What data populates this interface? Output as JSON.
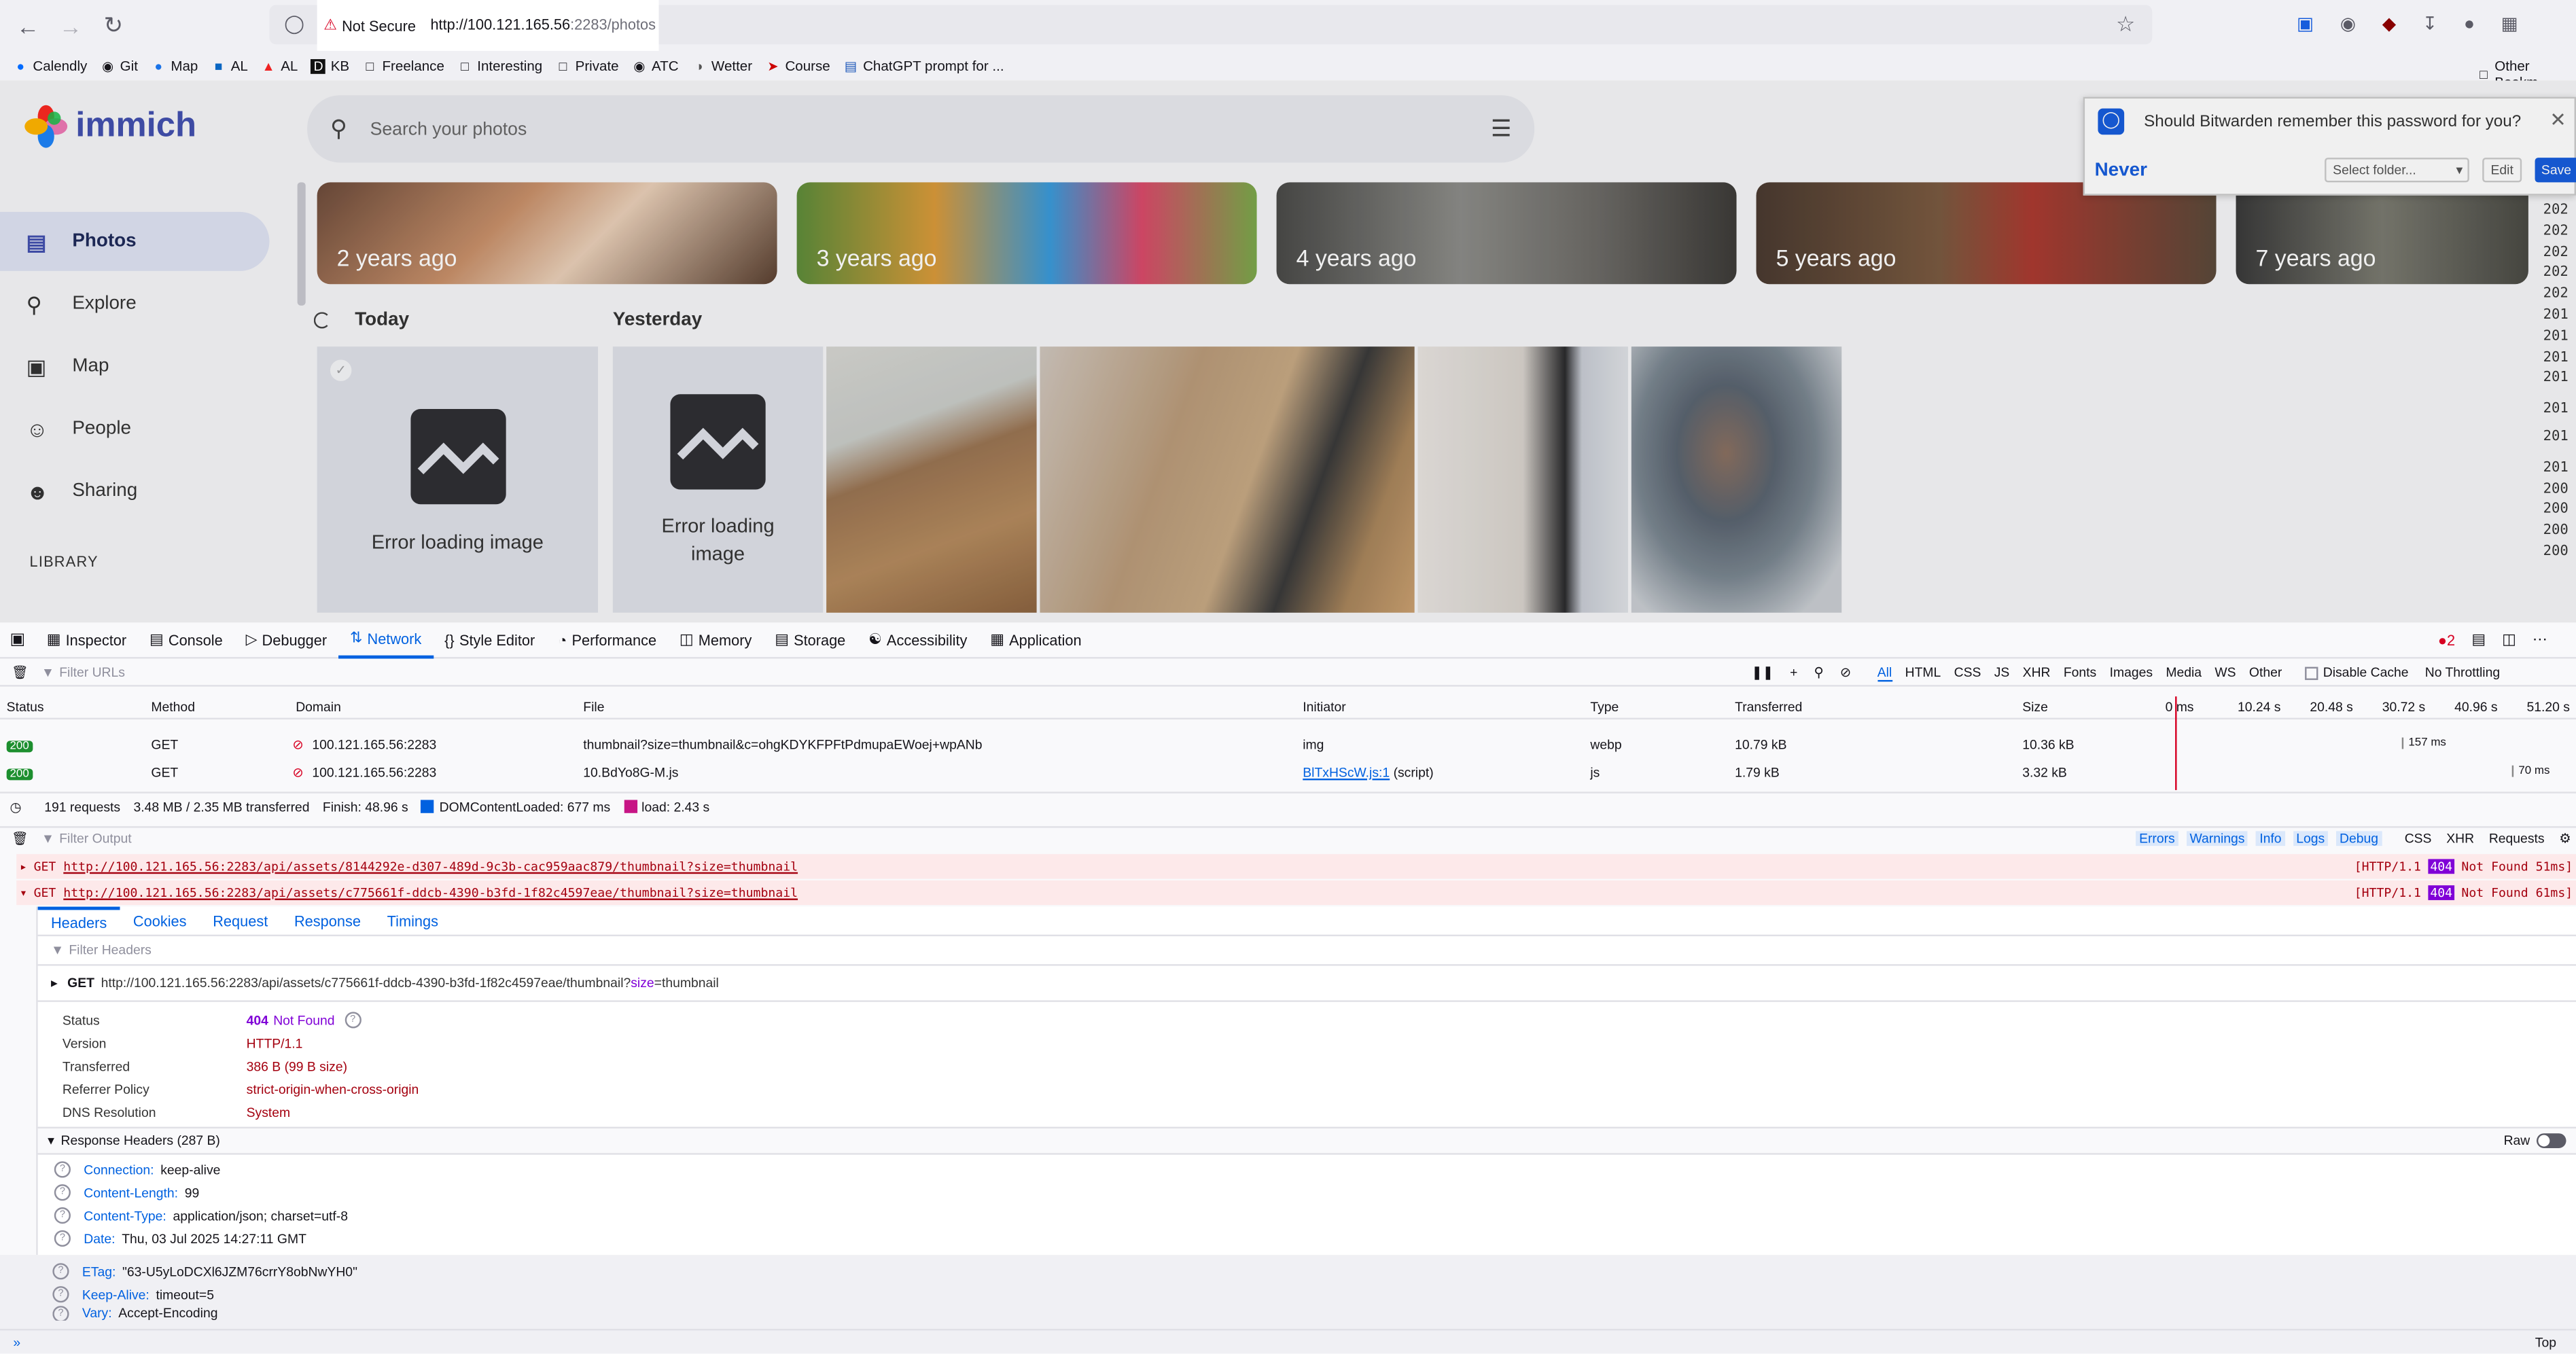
{
  "browser": {
    "security_label": "Not Secure",
    "url_host": "http://100.121.165.56",
    "url_rest": ":2283/photos",
    "bookmarks": [
      "Calendly",
      "Git",
      "Map",
      "AL",
      "AL",
      "KB",
      "Freelance",
      "Interesting",
      "Private",
      "ATC",
      "Wetter",
      "Course",
      "ChatGPT prompt for ..."
    ],
    "other_bookmarks": "Other Bookm"
  },
  "app": {
    "logo_text": "immich",
    "search_placeholder": "Search your photos",
    "nav": [
      "Photos",
      "Explore",
      "Map",
      "People",
      "Sharing"
    ],
    "library_heading": "LIBRARY",
    "memories": [
      "2 years ago",
      "3 years ago",
      "4 years ago",
      "5 years ago",
      "7 years ago"
    ],
    "groups": {
      "today": "Today",
      "yesterday": "Yesterday"
    },
    "error_text": "Error loading image",
    "timeline_years": [
      "202",
      "202",
      "202",
      "202",
      "202",
      "201",
      "201",
      "201",
      "201",
      "201",
      "201",
      "201",
      "200",
      "200",
      "200",
      "200"
    ]
  },
  "bitwarden": {
    "question": "Should Bitwarden remember this password for you?",
    "never": "Never",
    "folder_placeholder": "Select folder...",
    "edit": "Edit",
    "save": "Save"
  },
  "devtools": {
    "tabs": [
      "Inspector",
      "Console",
      "Debugger",
      "Network",
      "Style Editor",
      "Performance",
      "Memory",
      "Storage",
      "Accessibility",
      "Application"
    ],
    "error_count": "2",
    "filter_urls": "Filter URLs",
    "type_filters": [
      "All",
      "HTML",
      "CSS",
      "JS",
      "XHR",
      "Fonts",
      "Images",
      "Media",
      "WS",
      "Other"
    ],
    "disable_cache": "Disable Cache",
    "throttling": "No Throttling",
    "columns": [
      "Status",
      "Method",
      "Domain",
      "File",
      "Initiator",
      "Type",
      "Transferred",
      "Size"
    ],
    "timeline_ticks": [
      "0 ms",
      "10.24 s",
      "20.48 s",
      "30.72 s",
      "40.96 s",
      "51.20 s"
    ],
    "rows": [
      {
        "status": "200",
        "method": "GET",
        "domain": "100.121.165.56:2283",
        "file": "thumbnail?size=thumbnail&c=ohgKDYKFPFtPdmupaEWoej+wpANb",
        "initiator": "img",
        "type": "webp",
        "transferred": "10.79 kB",
        "size": "10.36 kB",
        "timing": "157 ms"
      },
      {
        "status": "200",
        "method": "GET",
        "domain": "100.121.165.56:2283",
        "file": "10.BdYo8G-M.js",
        "initiator": "BlTxHScW.js:1",
        "initiator_suffix": "(script)",
        "type": "js",
        "transferred": "1.79 kB",
        "size": "3.32 kB",
        "timing": "70 ms"
      }
    ],
    "summary": {
      "requests": "191 requests",
      "transferred": "3.48 MB / 2.35 MB transferred",
      "finish": "Finish: 48.96 s",
      "dcl": "DOMContentLoaded: 677 ms",
      "load": "load: 2.43 s"
    },
    "console": {
      "filter": "Filter Output",
      "levels": [
        "Errors",
        "Warnings",
        "Info",
        "Logs",
        "Debug"
      ],
      "kinds": [
        "CSS",
        "XHR",
        "Requests"
      ],
      "errors": [
        {
          "method": "GET",
          "url": "http://100.121.165.56:2283/api/assets/8144292e-d307-489d-9c3b-cac959aac879/thumbnail?size=thumbnail",
          "proto": "[HTTP/1.1",
          "code": "404",
          "rest": "Not Found 51ms]"
        },
        {
          "method": "GET",
          "url": "http://100.121.165.56:2283/api/assets/c775661f-ddcb-4390-b3fd-1f82c4597eae/thumbnail?size=thumbnail",
          "proto": "[HTTP/1.1",
          "code": "404",
          "rest": "Not Found 61ms]"
        }
      ]
    },
    "detail": {
      "tabs": [
        "Headers",
        "Cookies",
        "Request",
        "Response",
        "Timings"
      ],
      "filter_headers": "Filter Headers",
      "request_line_method": "GET",
      "request_line_url": "http://100.121.165.56:2283/api/assets/c775661f-ddcb-4390-b3fd-1f82c4597eae/thumbnail?",
      "request_line_param": "size",
      "request_line_value": "=thumbnail",
      "status_label": "Status",
      "status_code": "404",
      "status_text": "Not Found",
      "version_label": "Version",
      "version": "HTTP/1.1",
      "transferred_label": "Transferred",
      "transferred": "386 B (99 B size)",
      "referrer_label": "Referrer Policy",
      "referrer": "strict-origin-when-cross-origin",
      "dns_label": "DNS Resolution",
      "dns": "System",
      "response_headers_title": "Response Headers (287 B)",
      "raw_label": "Raw",
      "headers": [
        {
          "name": "Connection:",
          "value": "keep-alive"
        },
        {
          "name": "Content-Length:",
          "value": "99"
        },
        {
          "name": "Content-Type:",
          "value": "application/json; charset=utf-8"
        },
        {
          "name": "Date:",
          "value": "Thu, 03 Jul 2025 14:27:11 GMT"
        },
        {
          "name": "ETag:",
          "value": "\"63-U5yLoDCXl6JZM76crrY8obNwYH0\""
        },
        {
          "name": "Keep-Alive:",
          "value": "timeout=5"
        },
        {
          "name": "Vary:",
          "value": "Accept-Encoding"
        }
      ]
    },
    "bottom_right": "Top"
  }
}
